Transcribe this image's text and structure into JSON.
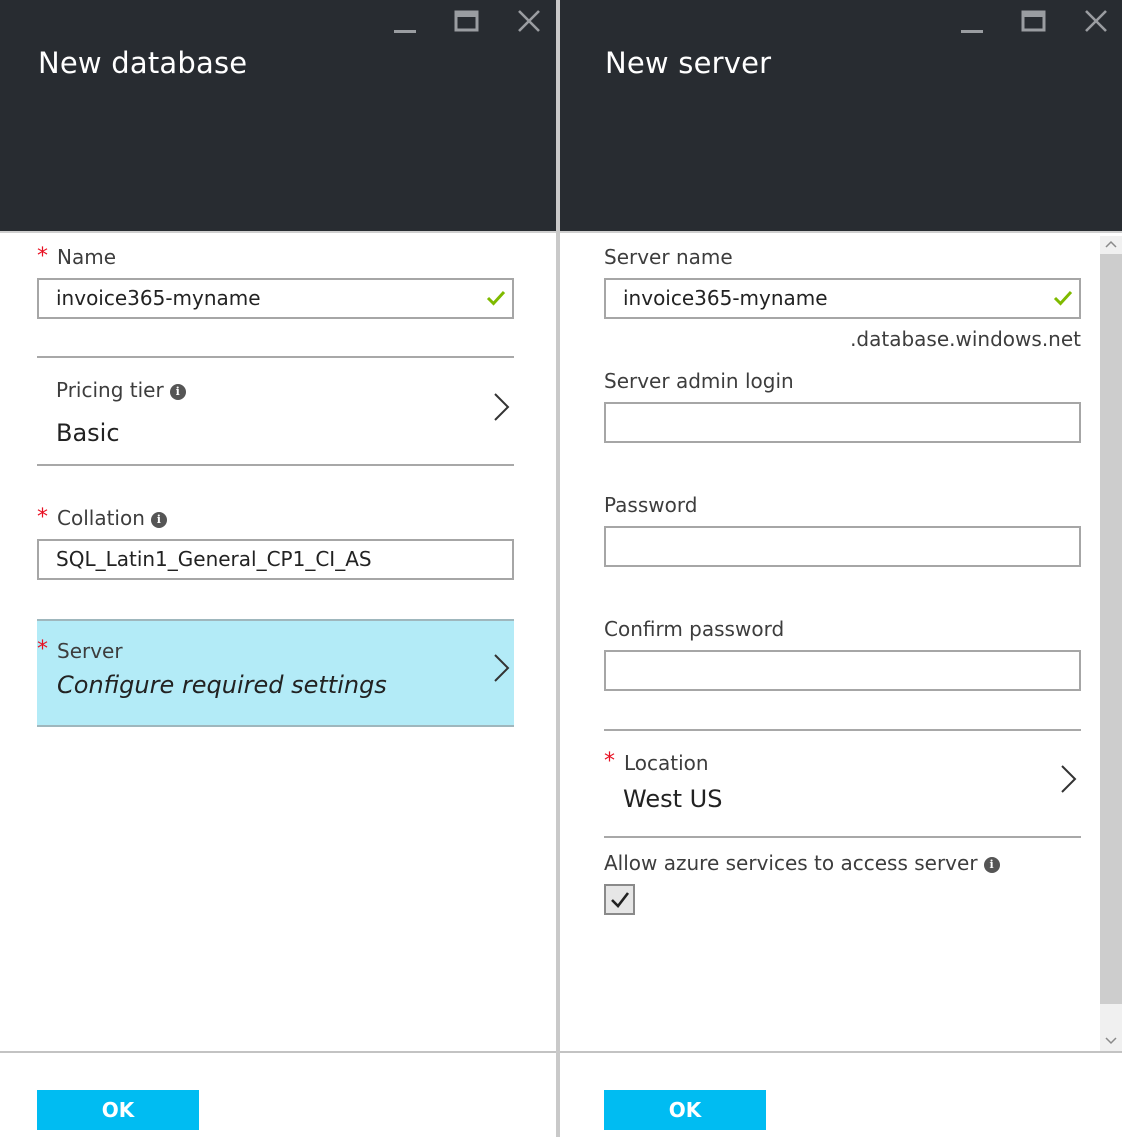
{
  "left_blade": {
    "title": "New database",
    "name_label": "Name",
    "name_value": "invoice365-myname",
    "pricing_label": "Pricing tier",
    "pricing_value": "Basic",
    "collation_label": "Collation",
    "collation_value": "SQL_Latin1_General_CP1_CI_AS",
    "server_label": "Server",
    "server_value": "Configure required settings",
    "ok_label": "OK"
  },
  "right_blade": {
    "title": "New server",
    "server_name_label": "Server name",
    "server_name_value": "invoice365-myname",
    "domain_suffix": ".database.windows.net",
    "admin_login_label": "Server admin login",
    "admin_login_value": "",
    "password_label": "Password",
    "password_value": "",
    "confirm_password_label": "Confirm password",
    "confirm_password_value": "",
    "location_label": "Location",
    "location_value": "West US",
    "allow_azure_label": "Allow azure services to access server",
    "allow_azure_checked": true,
    "ok_label": "OK"
  },
  "icons": {
    "required_marker": "*",
    "info_glyph": "i",
    "check_color": "#7fba00",
    "required_color": "#e81123",
    "accent_button": "#00bcf2",
    "selected_row": "#b3ebf7",
    "header_bg": "#282c31"
  }
}
